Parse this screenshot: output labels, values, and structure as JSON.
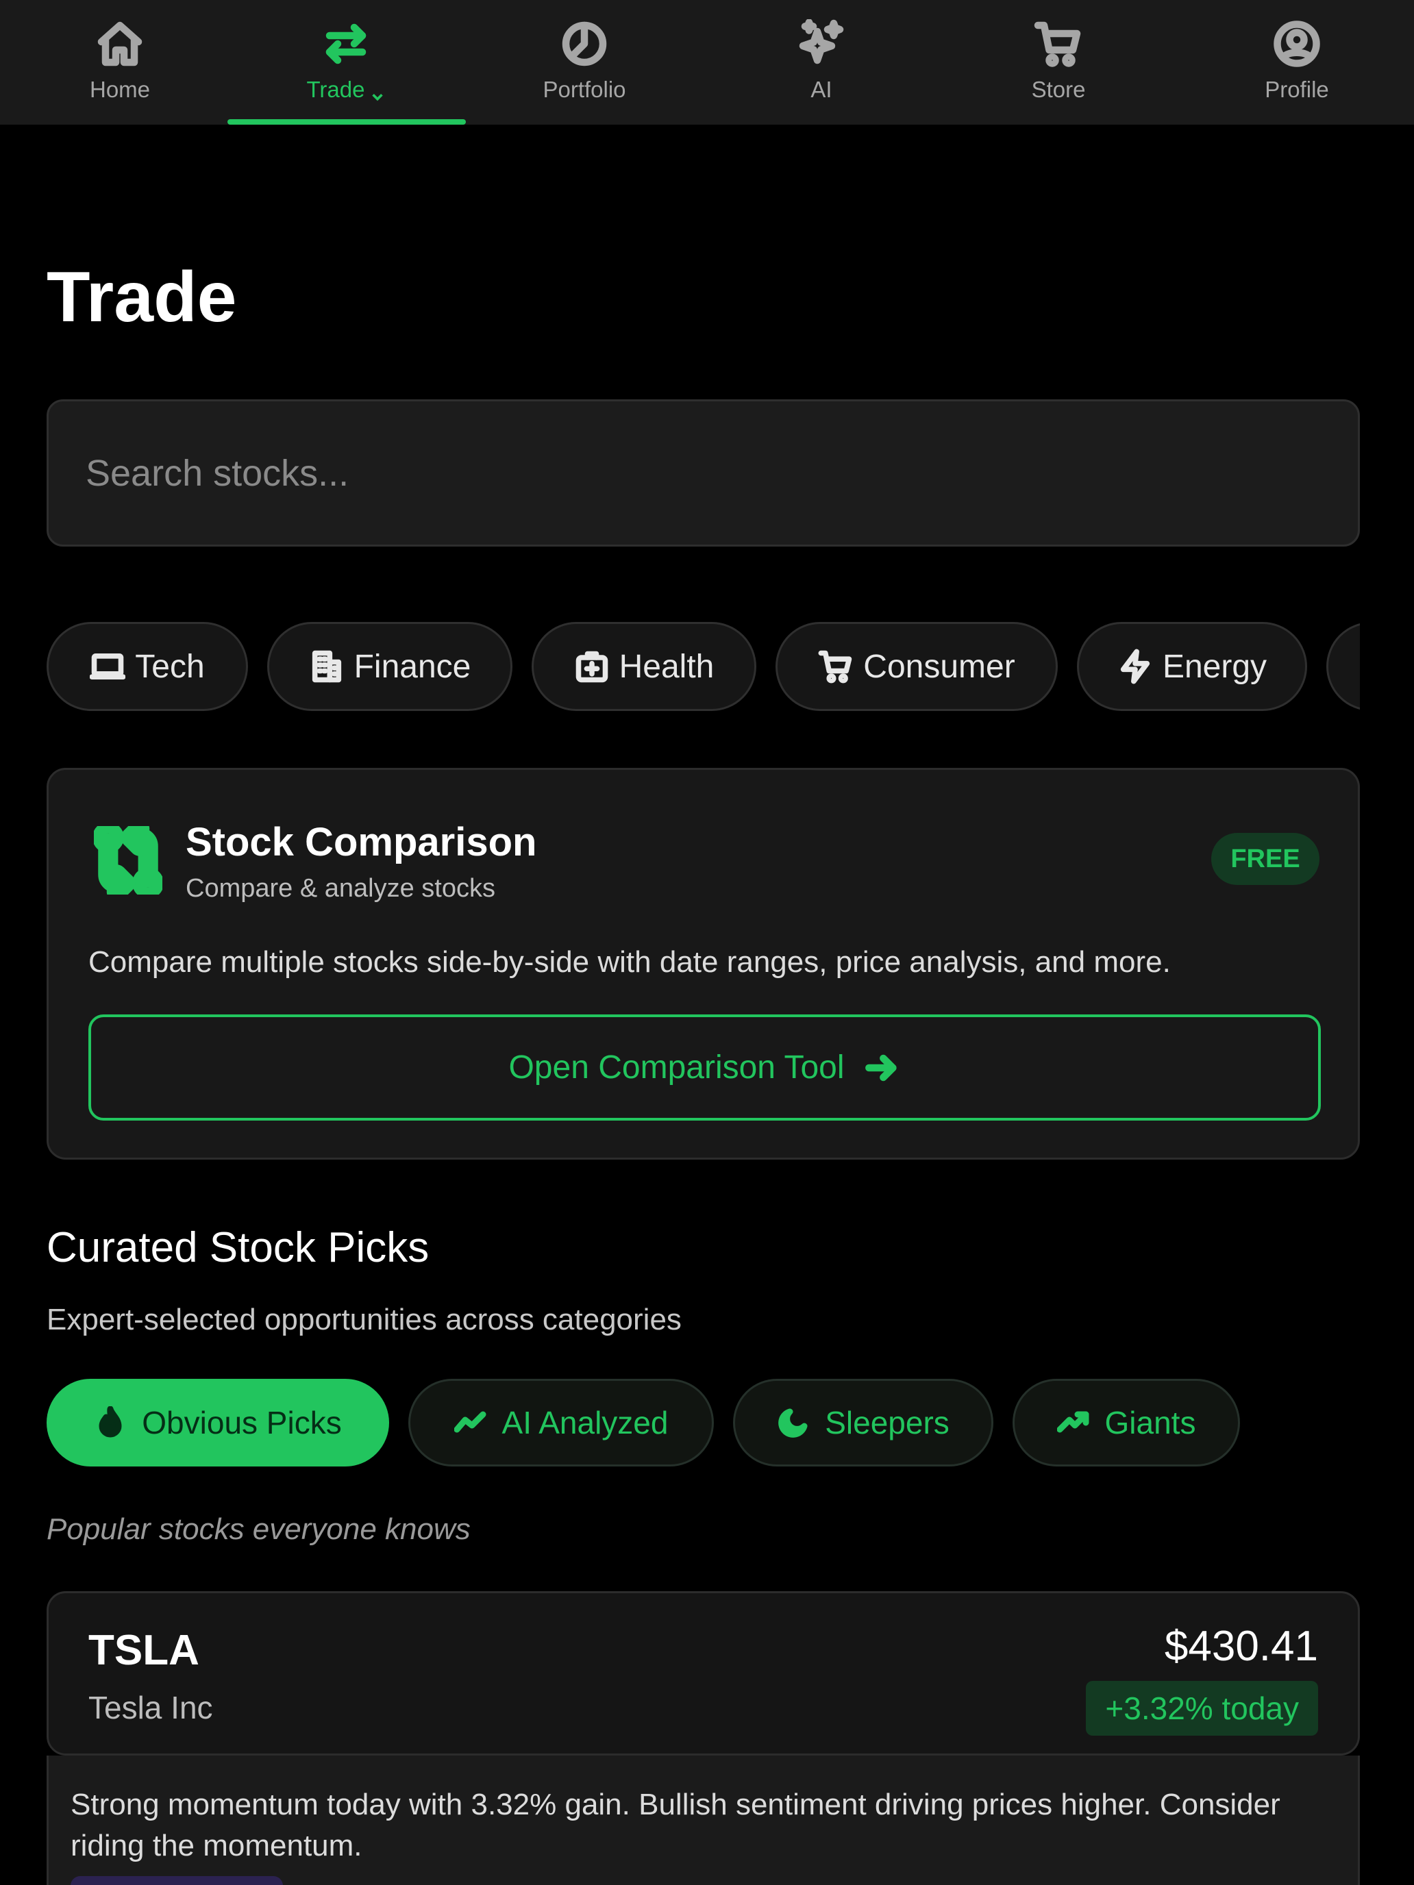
{
  "nav": {
    "items": [
      {
        "label": "Home",
        "icon": "home-icon"
      },
      {
        "label": "Trade",
        "icon": "swap-arrows-icon"
      },
      {
        "label": "Portfolio",
        "icon": "pie-chart-icon"
      },
      {
        "label": "AI",
        "icon": "sparkles-icon"
      },
      {
        "label": "Store",
        "icon": "cart-icon"
      },
      {
        "label": "Profile",
        "icon": "user-circle-icon"
      }
    ],
    "active": "Trade"
  },
  "page": {
    "title": "Trade"
  },
  "search": {
    "placeholder": "Search stocks..."
  },
  "categories": [
    {
      "label": "Tech",
      "icon": "laptop-icon"
    },
    {
      "label": "Finance",
      "icon": "building-icon"
    },
    {
      "label": "Health",
      "icon": "medical-box-icon"
    },
    {
      "label": "Consumer",
      "icon": "cart-icon"
    },
    {
      "label": "Energy",
      "icon": "lightning-icon"
    }
  ],
  "comparison": {
    "title": "Stock Comparison",
    "subtitle": "Compare & analyze stocks",
    "badge": "FREE",
    "description": "Compare multiple stocks side-by-side with date ranges, price analysis, and more.",
    "button": "Open Comparison Tool",
    "icon": "compare-arrows-icon"
  },
  "curated": {
    "title": "Curated Stock Picks",
    "subtitle": "Expert-selected opportunities across categories",
    "tabs": [
      {
        "label": "Obvious Picks",
        "icon": "flame-icon"
      },
      {
        "label": "AI Analyzed",
        "icon": "trend-line-icon"
      },
      {
        "label": "Sleepers",
        "icon": "moon-icon"
      },
      {
        "label": "Giants",
        "icon": "trending-up-icon"
      }
    ],
    "active_tab": "Obvious Picks",
    "note": "Popular stocks everyone knows"
  },
  "stock": {
    "ticker": "TSLA",
    "name": "Tesla Inc",
    "price": "$430.41",
    "change": "+3.32% today",
    "analysis": "Strong momentum today with 3.32% gain. Bullish sentiment driving prices higher. Consider riding the momentum."
  },
  "colors": {
    "accent": "#22c55e",
    "background": "#000000",
    "card": "#181818"
  }
}
